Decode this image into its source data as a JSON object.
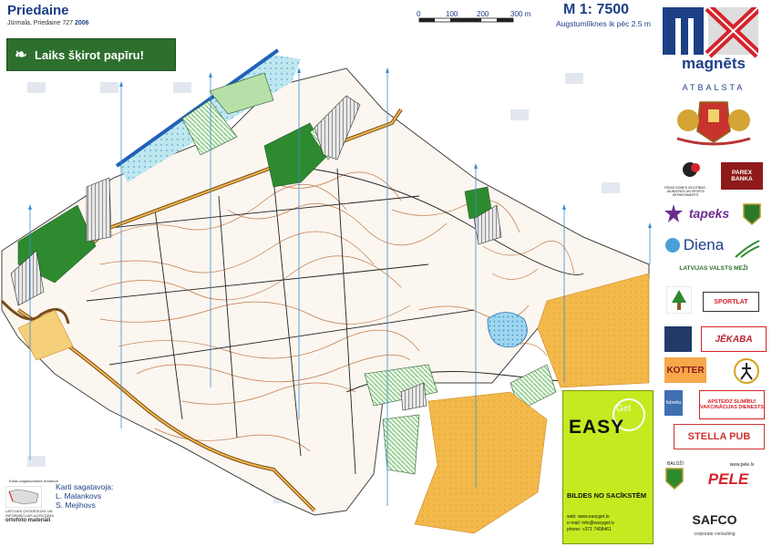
{
  "header": {
    "title": "Priedaine",
    "subtitle_place": "Jūrmala, Priedaine",
    "map_code": "727",
    "year": "2006",
    "scale_title": "M 1: 7500",
    "contour_note": "Augstumlīknes ik pēc 2.5 m",
    "scale_labels": [
      "0",
      "100",
      "200",
      "300 m"
    ]
  },
  "banner": {
    "text": "Laiks šķirot papīru!",
    "icon": "leaf-icon"
  },
  "credits": {
    "agency_lines": [
      "Karšu sagatavošanā izmantoti",
      "LATVIJAS ĢEODĒZIJAS UN",
      "INFORMĀCIJAS AĢENTŪRA",
      "ortofoto materiāli"
    ],
    "prepared_label": "Karti sagatavoja:",
    "authors": [
      "L. Malankovs",
      "S. Mejihovs"
    ]
  },
  "sidebar": {
    "brand": "magnēts",
    "supports": "ATBALSTA",
    "sponsors": [
      "RĪGAS DOMES IZGLĪTĪBAS, JAUNATNES UN SPORTA DEPARTAMENTS",
      "PAREX BANKA",
      "tapeks",
      "Diena",
      "LATVIJAS VALSTS MEŽI",
      "SPORTLAT",
      "JĒKABA",
      "KOTTER",
      "fabrelia",
      "APSTEIDZ SLIMĪBU! VAKCINĀCIJAS DIENESTS",
      "STELLA PUB",
      "BALOŽI",
      "PELE",
      "www.pele.lv",
      "SAFCO",
      "corporate consulting"
    ]
  },
  "ad": {
    "brand": "EASY",
    "superscript": "Get",
    "tagline": "BILDES NO SACĪKSTĒM",
    "contact": [
      "web: www.easyget.lv",
      "e-mail: info@easyget.lv",
      "phone: +371 7408461"
    ]
  },
  "colors": {
    "brand_blue": "#1c3f86",
    "brand_red": "#d6222a",
    "water_blue": "#3a8fd6",
    "vegetation_green": "#2e8a2f",
    "open_yellow": "#f2b13a",
    "contour_brown": "#b5652b"
  }
}
